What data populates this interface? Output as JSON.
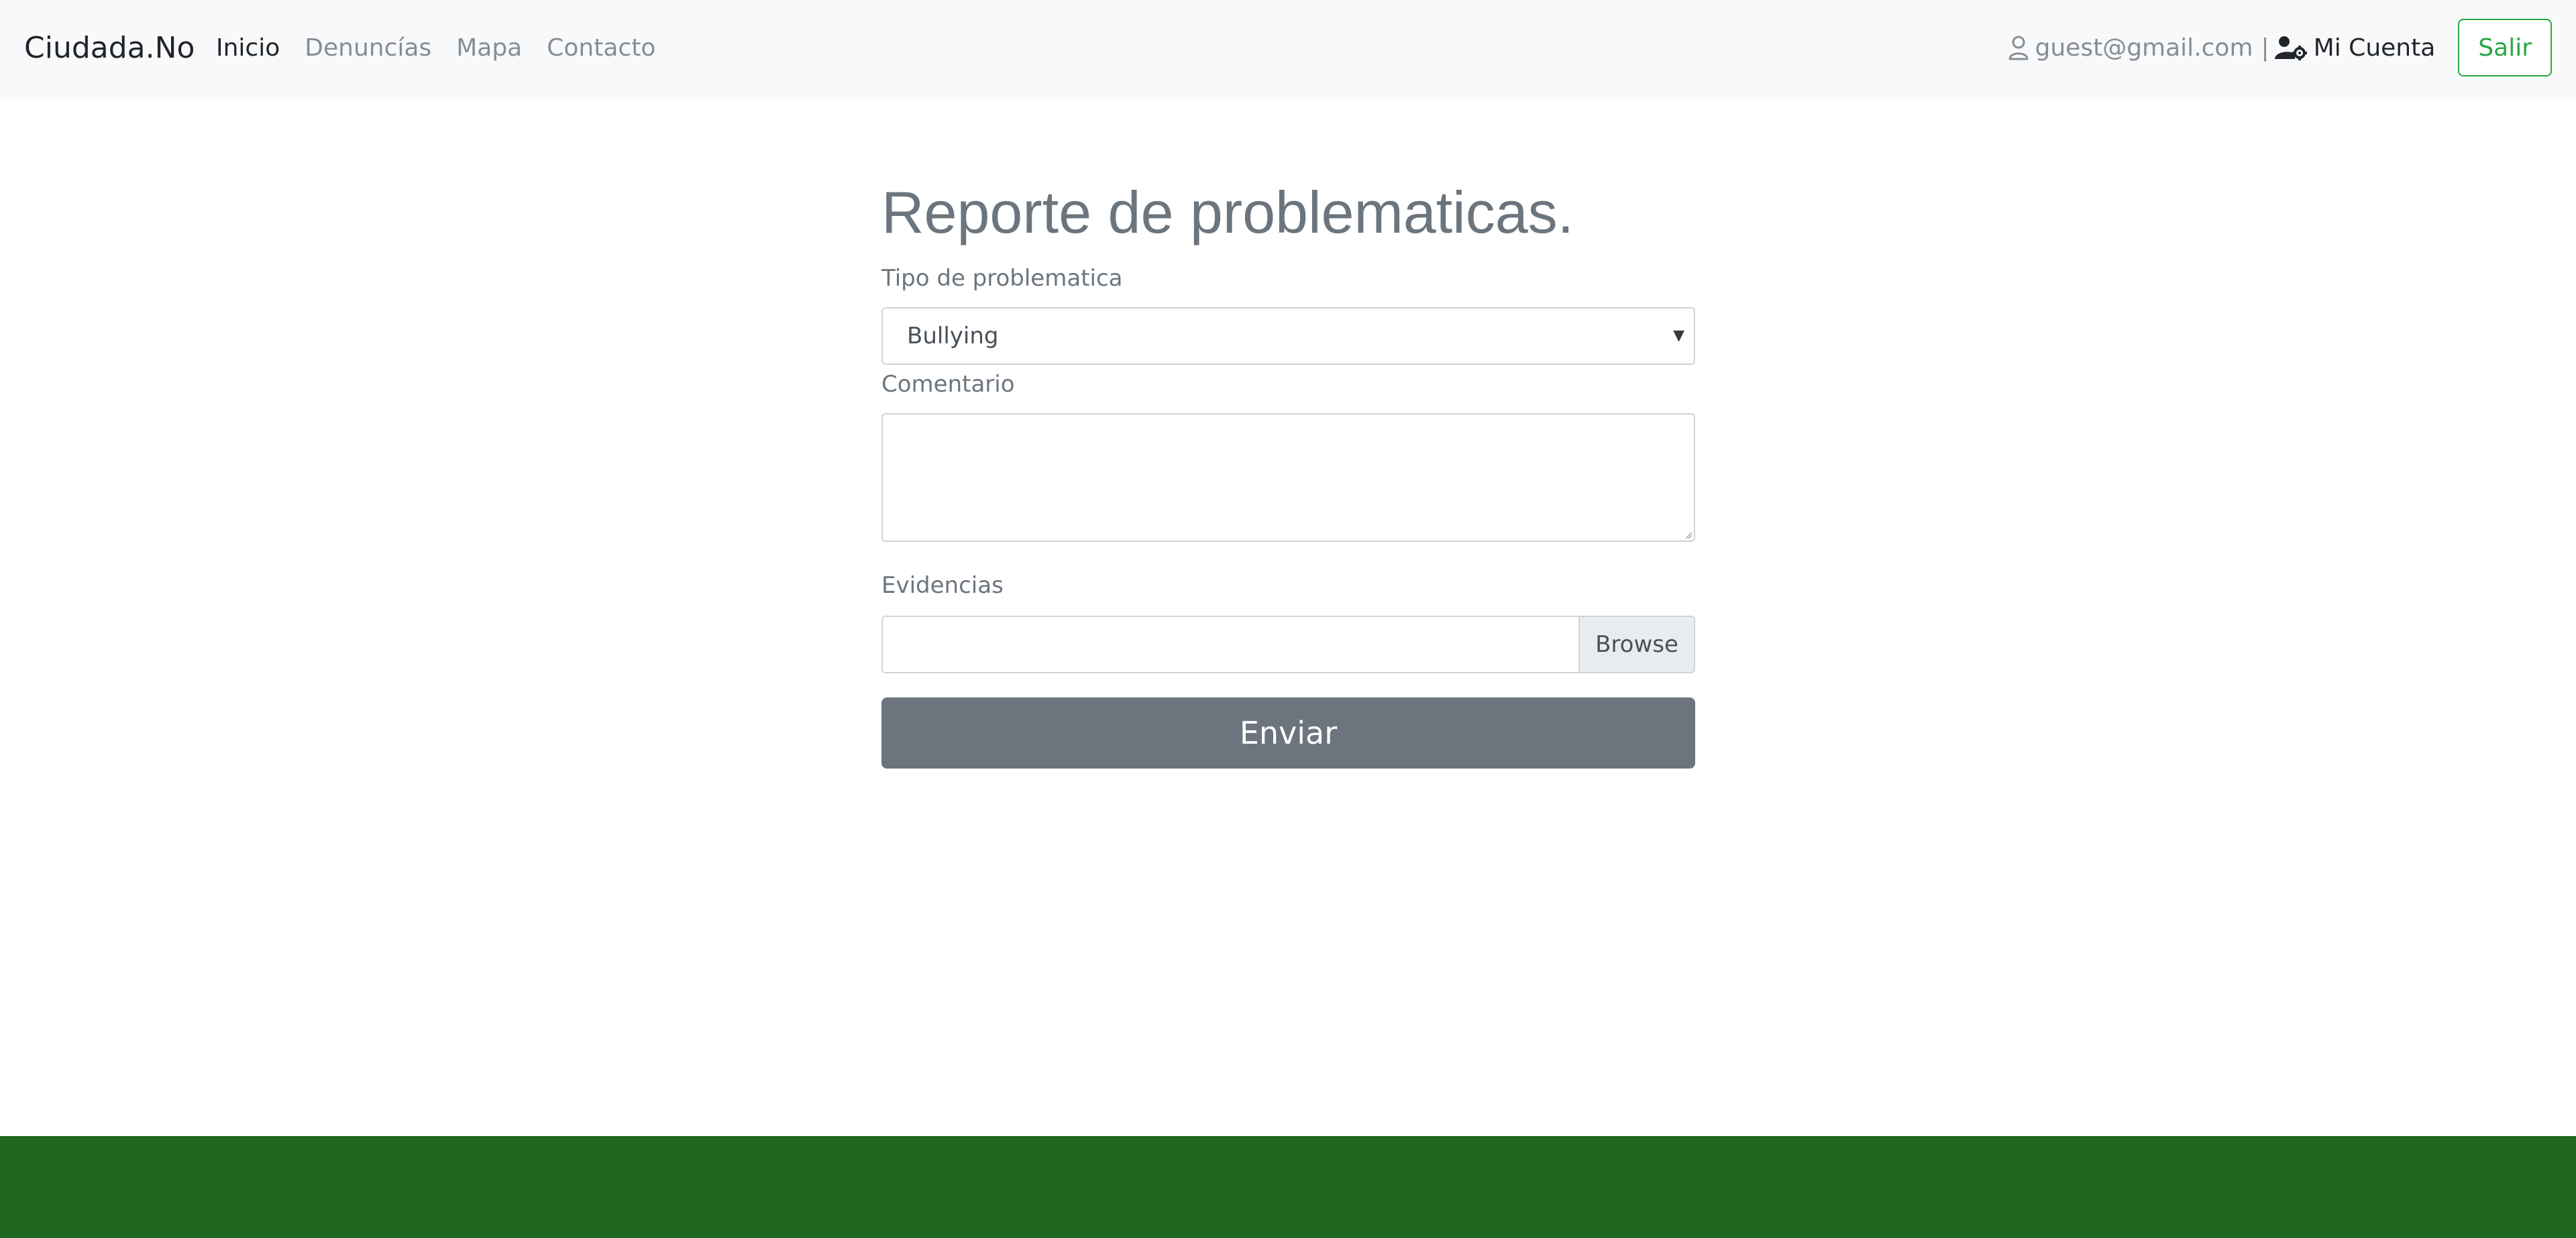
{
  "navbar": {
    "brand": "Ciudada.No",
    "links": [
      {
        "label": "Inicio",
        "active": true
      },
      {
        "label": "Denuncías",
        "active": false
      },
      {
        "label": "Mapa",
        "active": false
      },
      {
        "label": "Contacto",
        "active": false
      }
    ],
    "user_email": "guest@gmail.com",
    "separator": "|",
    "account_label": "Mi Cuenta",
    "logout_label": "Salir",
    "icons": {
      "user": "user-outline-icon",
      "account": "user-cog-icon"
    }
  },
  "form": {
    "title": "Reporte de problematicas.",
    "type_label": "Tipo de problematica",
    "type_selected": "Bullying",
    "comment_label": "Comentario",
    "comment_value": "",
    "evidence_label": "Evidencias",
    "browse_label": "Browse",
    "submit_label": "Enviar"
  },
  "colors": {
    "navbar_bg": "#f8f9fa",
    "accent_green": "#28a745",
    "footer_green": "#1f6620",
    "submit_gray": "#6c757d"
  }
}
